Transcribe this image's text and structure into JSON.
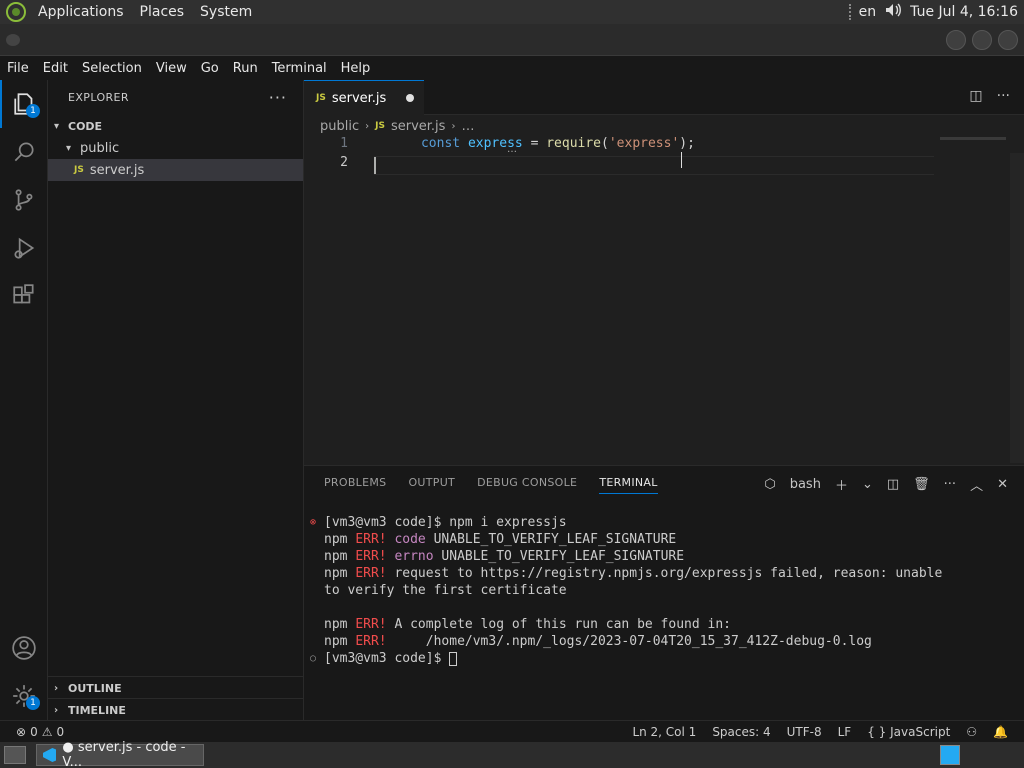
{
  "top_panel": {
    "menus": [
      "Applications",
      "Places",
      "System"
    ],
    "keyboard": "en",
    "clock": "Tue Jul 4, 16:16"
  },
  "menubar": [
    "File",
    "Edit",
    "Selection",
    "View",
    "Go",
    "Run",
    "Terminal",
    "Help"
  ],
  "activity": {
    "explorer_badge": "1",
    "settings_badge": "1"
  },
  "sidebar": {
    "title": "EXPLORER",
    "more": "···",
    "root": "CODE",
    "folder": "public",
    "file": "server.js",
    "file_badge": "JS",
    "outline": "OUTLINE",
    "timeline": "TIMELINE"
  },
  "editor": {
    "tab_label": "server.js",
    "tab_badge": "JS",
    "breadcrumb": {
      "folder": "public",
      "file": "server.js",
      "rest": "…"
    },
    "lines": [
      {
        "num": "1",
        "kw": "const",
        "var": "express",
        "op": "=",
        "fn": "require",
        "open": "(",
        "str": "'express'",
        "close": ");"
      },
      {
        "num": "2"
      }
    ],
    "hover_dots": "…"
  },
  "panel": {
    "tabs": [
      "PROBLEMS",
      "OUTPUT",
      "DEBUG CONSOLE",
      "TERMINAL"
    ],
    "shell": "bash",
    "terminal": [
      {
        "mark": "⊗",
        "text": "[vm3@vm3 code]$ npm i expressjs"
      },
      {
        "npm": "npm",
        "err": "ERR!",
        "key": "code",
        "text": "UNABLE_TO_VERIFY_LEAF_SIGNATURE"
      },
      {
        "npm": "npm",
        "err": "ERR!",
        "key": "errno",
        "text": "UNABLE_TO_VERIFY_LEAF_SIGNATURE"
      },
      {
        "npm": "npm",
        "err": "ERR!",
        "key": "",
        "text": "request to https://registry.npmjs.org/expressjs failed, reason: unable"
      },
      {
        "text": "to verify the first certificate"
      },
      {
        "text": ""
      },
      {
        "npm": "npm",
        "err": "ERR!",
        "key": "",
        "text": "A complete log of this run can be found in:"
      },
      {
        "npm": "npm",
        "err": "ERR!",
        "key": "",
        "text": "    /home/vm3/.npm/_logs/2023-07-04T20_15_37_412Z-debug-0.log"
      },
      {
        "mark": "○",
        "text": "[vm3@vm3 code]$ "
      }
    ]
  },
  "status": {
    "errors": "0",
    "warnings": "0",
    "position": "Ln 2, Col 1",
    "spaces": "Spaces: 4",
    "encoding": "UTF-8",
    "eol": "LF",
    "language": "JavaScript"
  },
  "taskbar": {
    "item": "● server.js - code - V..."
  }
}
